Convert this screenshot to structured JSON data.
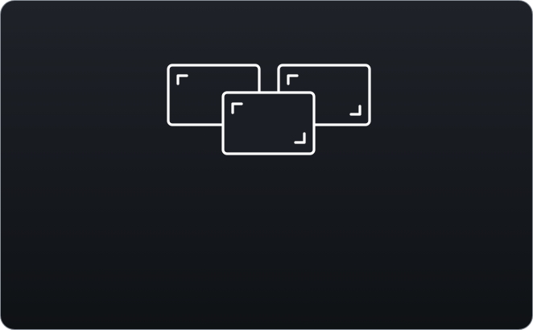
{
  "tile": {
    "action": "mission-control",
    "background_top": "#1f2329",
    "background_bottom": "#0f1215",
    "icon": "mission-control-icon",
    "icon_color": "#ffffff"
  }
}
